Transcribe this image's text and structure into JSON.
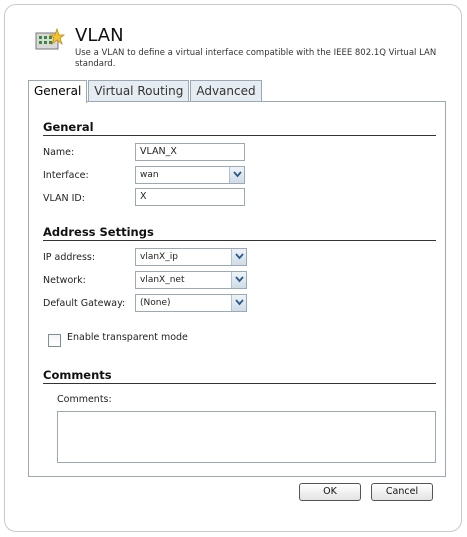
{
  "header": {
    "title": "VLAN",
    "description": "Use a VLAN to define a virtual interface compatible with the IEEE 802.1Q Virtual LAN standard.",
    "icon": "vlan-icon"
  },
  "tabs": [
    {
      "label": "General",
      "active": true
    },
    {
      "label": "Virtual Routing",
      "active": false
    },
    {
      "label": "Advanced",
      "active": false
    }
  ],
  "general": {
    "heading": "General",
    "name_label": "Name:",
    "name_value": "VLAN_X",
    "interface_label": "Interface:",
    "interface_value": "wan",
    "vlan_id_label": "VLAN ID:",
    "vlan_id_value": "X"
  },
  "address": {
    "heading": "Address Settings",
    "ip_label": "IP address:",
    "ip_value": "vlanX_ip",
    "network_label": "Network:",
    "network_value": "vlanX_net",
    "gateway_label": "Default Gateway:",
    "gateway_value": "(None)"
  },
  "transparent": {
    "label": "Enable transparent mode",
    "checked": false
  },
  "comments": {
    "heading": "Comments",
    "label": "Comments:",
    "value": ""
  },
  "buttons": {
    "ok": "OK",
    "cancel": "Cancel"
  },
  "colors": {
    "tab_bg": "#e6edf2",
    "border": "#9aa9b4"
  }
}
